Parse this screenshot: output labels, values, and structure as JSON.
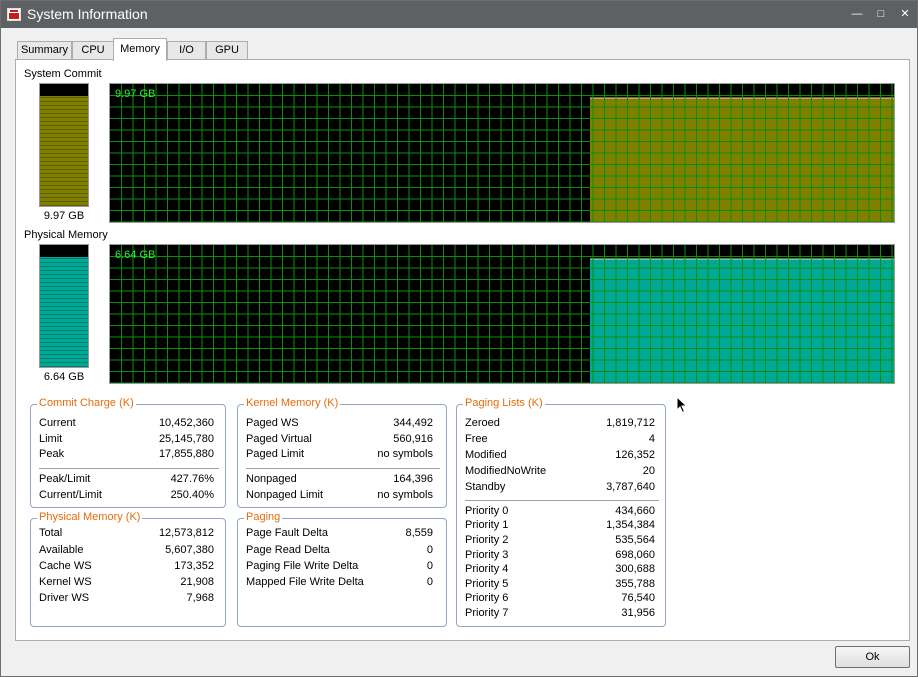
{
  "window": {
    "title": "System Information",
    "controls": {
      "minimize": "—",
      "maximize": "□",
      "close": "✕"
    }
  },
  "tabs": [
    {
      "label": "Summary",
      "active": false
    },
    {
      "label": "CPU",
      "active": false
    },
    {
      "label": "Memory",
      "active": true
    },
    {
      "label": "I/O",
      "active": false
    },
    {
      "label": "GPU",
      "active": false
    }
  ],
  "system_commit": {
    "label": "System Commit",
    "value": "9.97 GB",
    "graph_value": "9.97 GB",
    "color": "#7f7f00",
    "history_fraction": 0.9
  },
  "physical_memory_graph": {
    "label": "Physical Memory",
    "value": "6.64 GB",
    "graph_value": "6.64 GB",
    "color": "#00a896",
    "history_fraction": 0.9
  },
  "commit_charge": {
    "title": "Commit Charge (K)",
    "rows": [
      {
        "k": "Current",
        "v": "10,452,360"
      },
      {
        "k": "Limit",
        "v": "25,145,780"
      },
      {
        "k": "Peak",
        "v": "17,855,880"
      }
    ],
    "rows2": [
      {
        "k": "Peak/Limit",
        "v": "427.76%"
      },
      {
        "k": "Current/Limit",
        "v": "250.40%"
      }
    ]
  },
  "physical_memory": {
    "title": "Physical Memory (K)",
    "rows": [
      {
        "k": "Total",
        "v": "12,573,812"
      },
      {
        "k": "Available",
        "v": "5,607,380"
      },
      {
        "k": "Cache WS",
        "v": "173,352"
      },
      {
        "k": "Kernel WS",
        "v": "21,908"
      },
      {
        "k": "Driver WS",
        "v": "7,968"
      }
    ]
  },
  "kernel_memory": {
    "title": "Kernel Memory (K)",
    "rows": [
      {
        "k": "Paged WS",
        "v": "344,492"
      },
      {
        "k": "Paged Virtual",
        "v": "560,916"
      },
      {
        "k": "Paged Limit",
        "v": "no symbols"
      }
    ],
    "rows2": [
      {
        "k": "Nonpaged",
        "v": "164,396"
      },
      {
        "k": "Nonpaged Limit",
        "v": "no symbols"
      }
    ]
  },
  "paging": {
    "title": "Paging",
    "rows": [
      {
        "k": "Page Fault Delta",
        "v": "8,559"
      },
      {
        "k": "Page Read Delta",
        "v": "0"
      },
      {
        "k": "Paging File Write Delta",
        "v": "0"
      },
      {
        "k": "Mapped File Write Delta",
        "v": "0"
      }
    ]
  },
  "paging_lists": {
    "title": "Paging Lists (K)",
    "rows": [
      {
        "k": "Zeroed",
        "v": "1,819,712"
      },
      {
        "k": "Free",
        "v": "4"
      },
      {
        "k": "Modified",
        "v": "126,352"
      },
      {
        "k": "ModifiedNoWrite",
        "v": "20"
      },
      {
        "k": "Standby",
        "v": "3,787,640"
      }
    ],
    "rows2": [
      {
        "k": "Priority 0",
        "v": "434,660"
      },
      {
        "k": "Priority 1",
        "v": "1,354,384"
      },
      {
        "k": "Priority 2",
        "v": "535,564"
      },
      {
        "k": "Priority 3",
        "v": "698,060"
      },
      {
        "k": "Priority 4",
        "v": "300,688"
      },
      {
        "k": "Priority 5",
        "v": "355,788"
      },
      {
        "k": "Priority 6",
        "v": "76,540"
      },
      {
        "k": "Priority 7",
        "v": "31,956"
      }
    ]
  },
  "buttons": {
    "ok": "Ok"
  },
  "colors": {
    "grid": "#0b8f0b",
    "graph_text": "#2cf52c",
    "group_title": "#e46c0a"
  }
}
